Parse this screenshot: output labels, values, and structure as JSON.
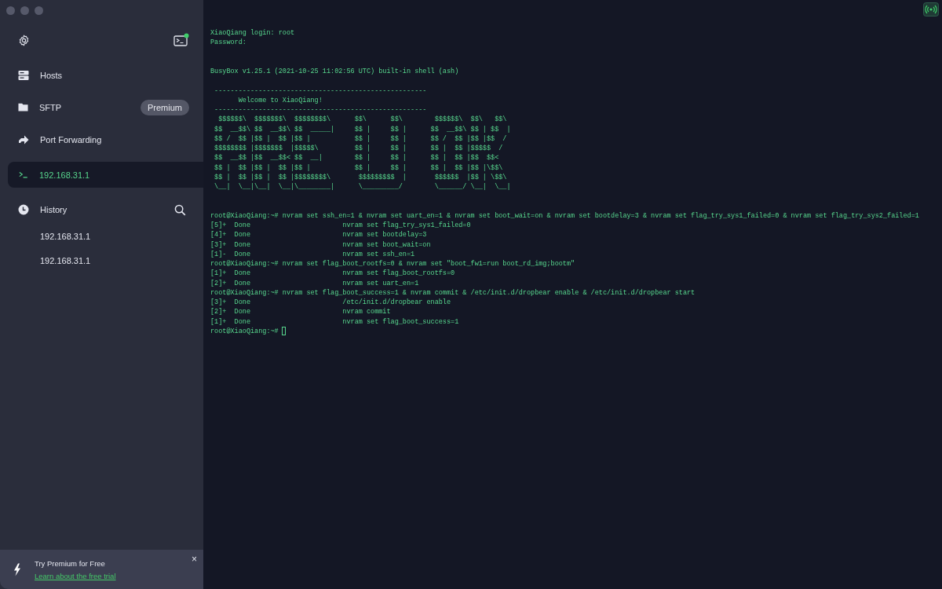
{
  "sidebar": {
    "nav": [
      {
        "label": "Hosts"
      },
      {
        "label": "SFTP",
        "badge": "Premium"
      },
      {
        "label": "Port Forwarding"
      }
    ],
    "sessions": [
      {
        "label": "192.168.31.1",
        "selected": true
      }
    ],
    "history": {
      "title": "History",
      "items": [
        "192.168.31.1",
        "192.168.31.1"
      ]
    },
    "promo": {
      "title": "Try Premium for Free",
      "link": "Learn about the free trial",
      "close": "×"
    }
  },
  "terminal": {
    "blocks": [
      {
        "lines": [
          "XiaoQiang login: root",
          "Password:"
        ]
      },
      {
        "lines": [
          "BusyBox v1.25.1 (2021-10-25 11:02:56 UTC) built-in shell (ash)"
        ]
      },
      {
        "lines": [
          " -----------------------------------------------------",
          "       Welcome to XiaoQiang!",
          " -----------------------------------------------------",
          "  $$$$$$\\  $$$$$$$\\  $$$$$$$$\\      $$\\      $$\\        $$$$$$\\  $$\\   $$\\",
          " $$  __$$\\ $$  __$$\\ $$  _____|     $$ |     $$ |      $$  __$$\\ $$ | $$  |",
          " $$ /  $$ |$$ |  $$ |$$ |           $$ |     $$ |      $$ /  $$ |$$ |$$  /",
          " $$$$$$$$ |$$$$$$$  |$$$$$\\         $$ |     $$ |      $$ |  $$ |$$$$$  /",
          " $$  __$$ |$$  __$$< $$  __|        $$ |     $$ |      $$ |  $$ |$$  $$<",
          " $$ |  $$ |$$ |  $$ |$$ |           $$ |     $$ |      $$ |  $$ |$$ |\\$$\\",
          " $$ |  $$ |$$ |  $$ |$$$$$$$$\\       $$$$$$$$$  |       $$$$$$  |$$ | \\$$\\",
          " \\__|  \\__|\\__|  \\__|\\________|      \\_________/        \\______/ \\__|  \\__|"
        ]
      },
      {
        "lines": [
          "root@XiaoQiang:~# nvram set ssh_en=1 & nvram set uart_en=1 & nvram set boot_wait=on & nvram set bootdelay=3 & nvram set flag_try_sys1_failed=0 & nvram set flag_try_sys2_failed=1",
          "[5]+  Done                       nvram set flag_try_sys1_failed=0",
          "[4]+  Done                       nvram set bootdelay=3",
          "[3]+  Done                       nvram set boot_wait=on",
          "[1]-  Done                       nvram set ssh_en=1",
          "root@XiaoQiang:~# nvram set flag_boot_rootfs=0 & nvram set \"boot_fw1=run boot_rd_img;bootm\"",
          "[1]+  Done                       nvram set flag_boot_rootfs=0",
          "[2]+  Done                       nvram set uart_en=1",
          "root@XiaoQiang:~# nvram set flag_boot_success=1 & nvram commit & /etc/init.d/dropbear enable & /etc/init.d/dropbear start",
          "[3]+  Done                       /etc/init.d/dropbear enable",
          "[2]+  Done                       nvram commit",
          "[1]+  Done                       nvram set flag_boot_success=1"
        ],
        "prompt": "root@XiaoQiang:~#"
      }
    ]
  }
}
